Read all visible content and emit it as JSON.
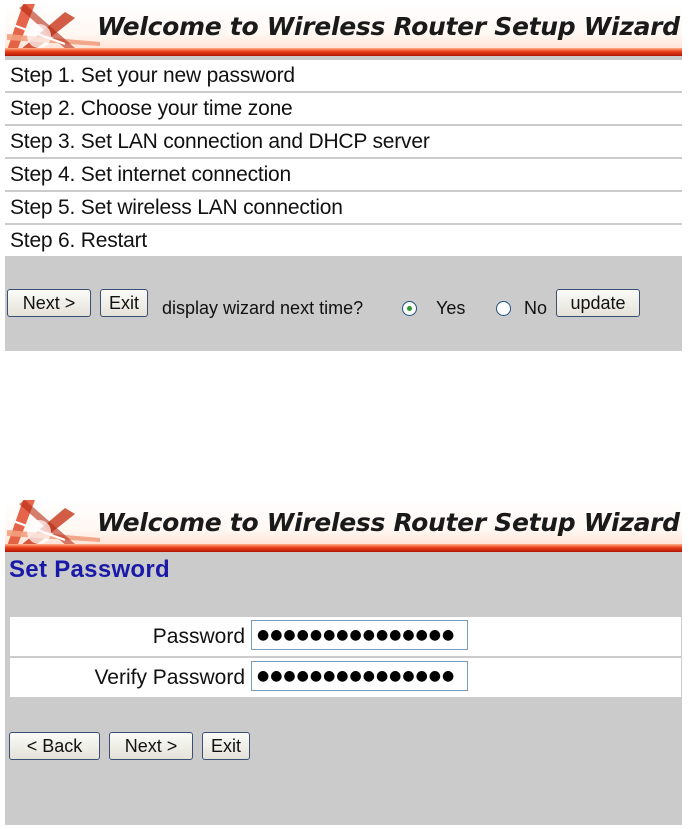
{
  "panel1": {
    "banner_title": "Welcome to Wireless Router Setup Wizard",
    "steps": [
      "Step 1. Set your new password",
      "Step 2. Choose your time zone",
      "Step 3. Set LAN connection and DHCP server",
      "Step 4. Set internet connection",
      "Step 5. Set wireless LAN connection",
      "Step 6. Restart"
    ],
    "next_label": "Next >",
    "exit_label": "Exit",
    "display_question": "display wizard next time?",
    "yes_label": "Yes",
    "no_label": "No",
    "selected_option": "Yes",
    "update_label": "update"
  },
  "panel2": {
    "banner_title": "Welcome to Wireless Router Setup Wizard",
    "section_title": "Set Password",
    "password_label": "Password",
    "password_value": "●●●●●●●●●●●●●●●",
    "verify_label": "Verify Password",
    "verify_value": "●●●●●●●●●●●●●●●",
    "back_label": "< Back",
    "next_label": "Next >",
    "exit_label": "Exit"
  },
  "colors": {
    "panel_bg": "#cbcbcb",
    "banner_red": "#e8401a",
    "section_title_blue": "#1a1aa8"
  }
}
